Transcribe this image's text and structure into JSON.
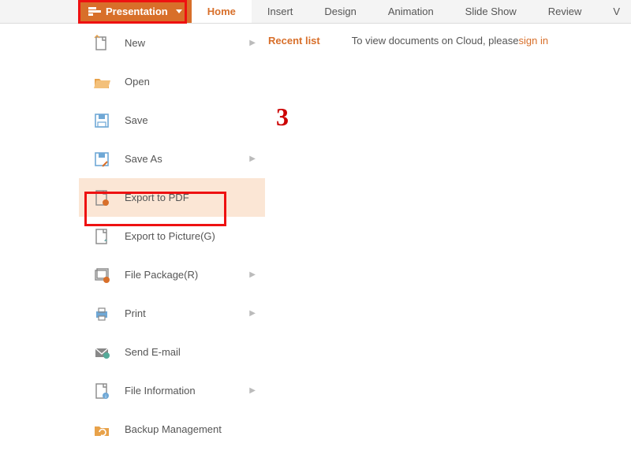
{
  "colors": {
    "accent": "#d86f2a",
    "highlight_red": "#e11"
  },
  "app_button": {
    "label": "Presentation"
  },
  "tabs": [
    {
      "label": "Home",
      "active": true
    },
    {
      "label": "Insert"
    },
    {
      "label": "Design"
    },
    {
      "label": "Animation"
    },
    {
      "label": "Slide Show"
    },
    {
      "label": "Review"
    },
    {
      "label": "V"
    }
  ],
  "menu": [
    {
      "name": "new",
      "label": "New",
      "icon": "new-file",
      "submenu": true
    },
    {
      "name": "open",
      "label": "Open",
      "icon": "open-folder",
      "submenu": false
    },
    {
      "name": "save",
      "label": "Save",
      "icon": "save-disk",
      "submenu": false
    },
    {
      "name": "save-as",
      "label": "Save As",
      "icon": "save-as",
      "submenu": true
    },
    {
      "name": "export-pdf",
      "label": "Export to PDF",
      "icon": "export-pdf",
      "submenu": false,
      "selected": true
    },
    {
      "name": "export-picture",
      "label": "Export to Picture(G)",
      "icon": "export-pic",
      "submenu": false
    },
    {
      "name": "file-package",
      "label": "File Package(R)",
      "icon": "package",
      "submenu": true
    },
    {
      "name": "print",
      "label": "Print",
      "icon": "print",
      "submenu": true
    },
    {
      "name": "send-email",
      "label": "Send E-mail",
      "icon": "email",
      "submenu": false
    },
    {
      "name": "file-info",
      "label": "File Information",
      "icon": "file-info",
      "submenu": true
    },
    {
      "name": "backup",
      "label": "Backup Management",
      "icon": "backup",
      "submenu": false
    }
  ],
  "recent": {
    "heading": "Recent list",
    "cloud_msg": "To view documents on Cloud, please",
    "signin": "sign in"
  },
  "annotation": {
    "step_number": "3"
  }
}
